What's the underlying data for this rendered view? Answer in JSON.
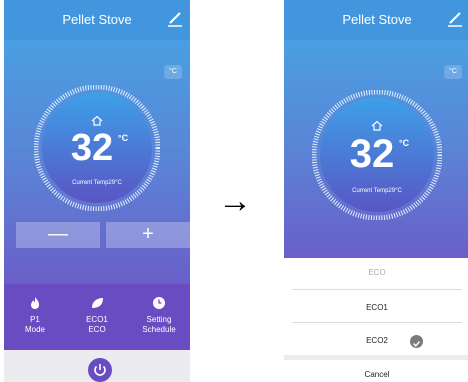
{
  "left": {
    "title": "Pellet Stove",
    "unit_badge": "°C",
    "temperature": "32",
    "temperature_unit": "°C",
    "current_temp": "Current Temp29°C",
    "minus_label": "—",
    "plus_label": "+",
    "modes": [
      {
        "line1": "P1",
        "line2": "Mode",
        "icon": "flame-icon"
      },
      {
        "line1": "ECO1",
        "line2": "ECO",
        "icon": "leaf-icon"
      },
      {
        "line1": "Setting",
        "line2": "Schedule",
        "icon": "clock-icon"
      }
    ],
    "power_icon": "power-icon"
  },
  "arrow": "→",
  "right": {
    "title": "Pellet Stove",
    "unit_badge": "°C",
    "temperature": "32",
    "temperature_unit": "°C",
    "current_temp": "Current Temp29°C",
    "sheet": {
      "header": "ECO",
      "options": [
        "ECO1",
        "ECO2"
      ],
      "selected": "ECO2",
      "cancel": "Cancel"
    }
  },
  "colors": {
    "topbar": "#4296de",
    "accent_purple": "#6a4cc2",
    "header_grey": "#aaaaaa"
  }
}
